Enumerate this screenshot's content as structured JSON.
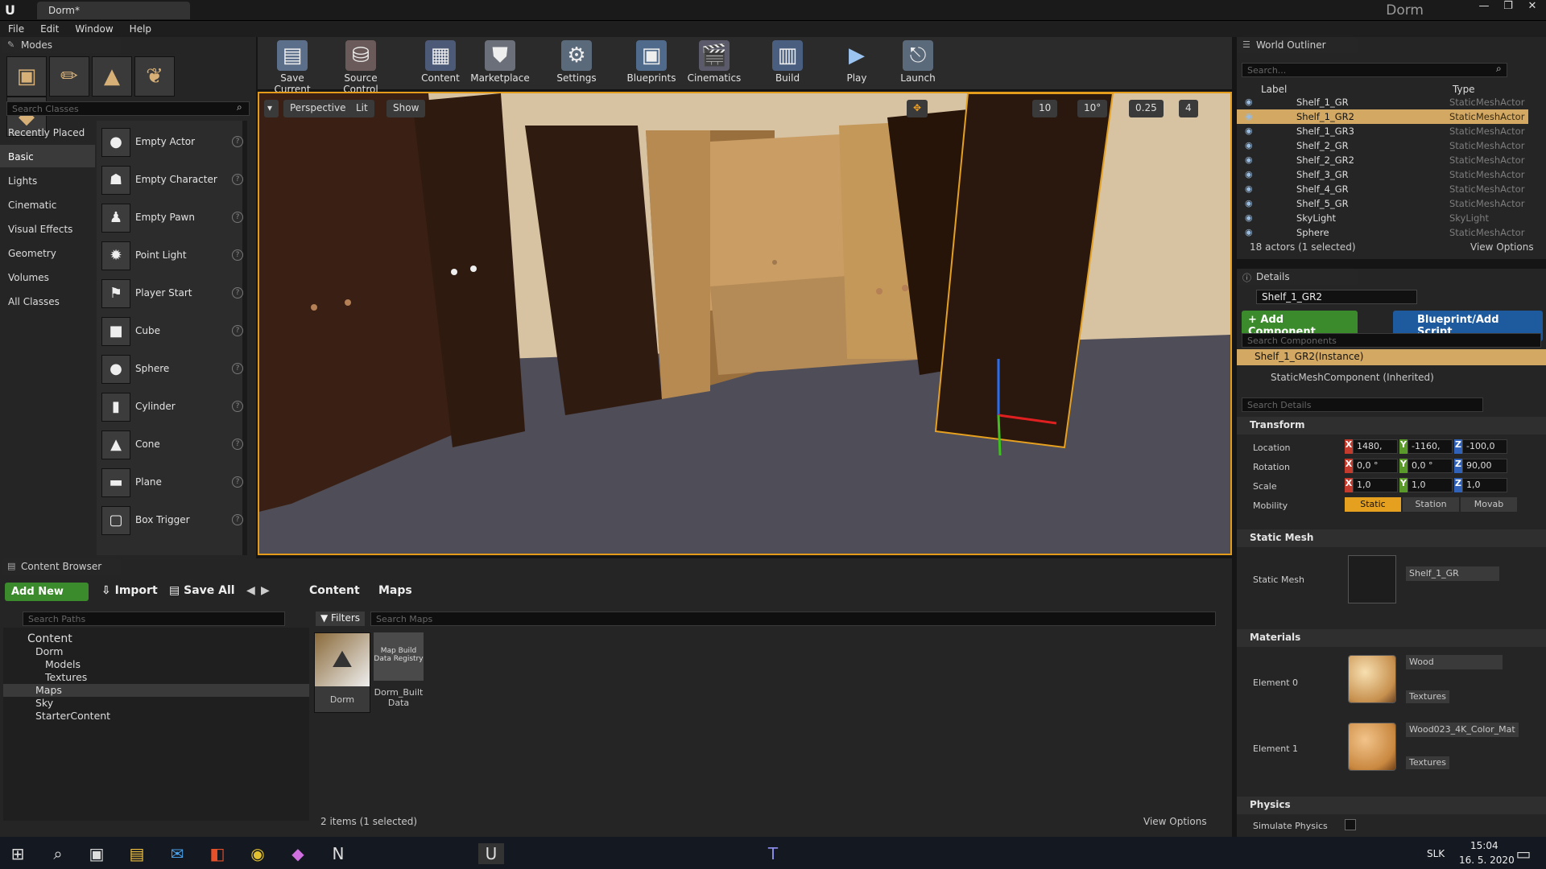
{
  "window": {
    "tab_title": "Dorm*",
    "project_name": "Dorm",
    "minimize": "—",
    "maximize": "❐",
    "close": "✕"
  },
  "menu": [
    "File",
    "Edit",
    "Window",
    "Help"
  ],
  "modes": {
    "tab_label": "Modes",
    "search_placeholder": "Search Classes",
    "categories": [
      "Recently Placed",
      "Basic",
      "Lights",
      "Cinematic",
      "Visual Effects",
      "Geometry",
      "Volumes",
      "All Classes"
    ],
    "selected_category": "Basic",
    "classes": [
      "Empty Actor",
      "Empty Character",
      "Empty Pawn",
      "Point Light",
      "Player Start",
      "Cube",
      "Sphere",
      "Cylinder",
      "Cone",
      "Plane",
      "Box Trigger"
    ]
  },
  "toolbar": {
    "items": [
      {
        "label": "Save Current",
        "icon": "save-icon"
      },
      {
        "label": "Source Control",
        "icon": "source-control-icon"
      },
      {
        "label": "Content",
        "icon": "content-icon"
      },
      {
        "label": "Marketplace",
        "icon": "marketplace-icon"
      },
      {
        "label": "Settings",
        "icon": "settings-icon"
      },
      {
        "label": "Blueprints",
        "icon": "blueprints-icon"
      },
      {
        "label": "Cinematics",
        "icon": "cinematics-icon"
      },
      {
        "label": "Build",
        "icon": "build-icon"
      },
      {
        "label": "Play",
        "icon": "play-icon"
      },
      {
        "label": "Launch",
        "icon": "launch-icon"
      }
    ]
  },
  "viewport": {
    "perspective": "Perspective",
    "lit": "Lit",
    "show": "Show",
    "grid_snap": "10",
    "rotation_snap": "10°",
    "scale_snap": "0.25",
    "camera_speed": "4"
  },
  "outliner": {
    "tab_label": "World Outliner",
    "search_placeholder": "Search...",
    "col_label": "Label",
    "col_type": "Type",
    "rows": [
      {
        "name": "Shelf_1_GR",
        "type": "StaticMeshActor"
      },
      {
        "name": "Shelf_1_GR2",
        "type": "StaticMeshActor"
      },
      {
        "name": "Shelf_1_GR3",
        "type": "StaticMeshActor"
      },
      {
        "name": "Shelf_2_GR",
        "type": "StaticMeshActor"
      },
      {
        "name": "Shelf_2_GR2",
        "type": "StaticMeshActor"
      },
      {
        "name": "Shelf_3_GR",
        "type": "StaticMeshActor"
      },
      {
        "name": "Shelf_4_GR",
        "type": "StaticMeshActor"
      },
      {
        "name": "Shelf_5_GR",
        "type": "StaticMeshActor"
      },
      {
        "name": "SkyLight",
        "type": "SkyLight"
      },
      {
        "name": "Sphere",
        "type": "StaticMeshActor"
      }
    ],
    "selected": "Shelf_1_GR2",
    "status": "18 actors (1 selected)",
    "view_options": "View Options"
  },
  "details": {
    "tab_label": "Details",
    "actor_name": "Shelf_1_GR2",
    "add_component": "+ Add Component",
    "blueprint_script": "Blueprint/Add Script",
    "search_components": "Search Components",
    "instance": "Shelf_1_GR2(Instance)",
    "component": "StaticMeshComponent (Inherited)",
    "search_details": "Search Details",
    "transform": {
      "title": "Transform",
      "location_label": "Location",
      "rotation_label": "Rotation",
      "scale_label": "Scale",
      "mobility_label": "Mobility",
      "location": [
        "1480,",
        "-1160,",
        "-100,0"
      ],
      "rotation": [
        "0,0 °",
        "0,0 °",
        "90,00"
      ],
      "scale": [
        "1,0",
        "1,0",
        "1,0"
      ],
      "mobility": [
        "Static",
        "Station",
        "Movab"
      ]
    },
    "static_mesh": {
      "title": "Static Mesh",
      "label": "Static Mesh",
      "value": "Shelf_1_GR"
    },
    "materials": {
      "title": "Materials",
      "elements": [
        {
          "label": "Element 0",
          "value": "Wood",
          "textures": "Textures"
        },
        {
          "label": "Element 1",
          "value": "Wood023_4K_Color_Mat",
          "textures": "Textures"
        }
      ]
    },
    "physics": {
      "title": "Physics",
      "simulate": "Simulate Physics"
    }
  },
  "content_browser": {
    "tab_label": "Content Browser",
    "add_new": "Add New",
    "import": "Import",
    "save_all": "Save All",
    "path": [
      "Content",
      "Maps"
    ],
    "search_paths": "Search Paths",
    "filters": "Filters",
    "search_maps": "Search Maps",
    "tree": [
      {
        "label": "Content",
        "level": 0
      },
      {
        "label": "Dorm",
        "level": 1
      },
      {
        "label": "Models",
        "level": 2
      },
      {
        "label": "Textures",
        "level": 2
      },
      {
        "label": "Maps",
        "level": 1
      },
      {
        "label": "Sky",
        "level": 1
      },
      {
        "label": "StarterContent",
        "level": 1
      }
    ],
    "assets": [
      {
        "name": "Dorm",
        "caption": "Dorm"
      },
      {
        "name": "Map Build Data Registry",
        "caption": "Dorm_Built Data"
      }
    ],
    "status": "2 items (1 selected)",
    "view_options": "View Options"
  },
  "taskbar": {
    "time": "15:04",
    "date": "16. 5. 2020",
    "lang": "SLK"
  }
}
